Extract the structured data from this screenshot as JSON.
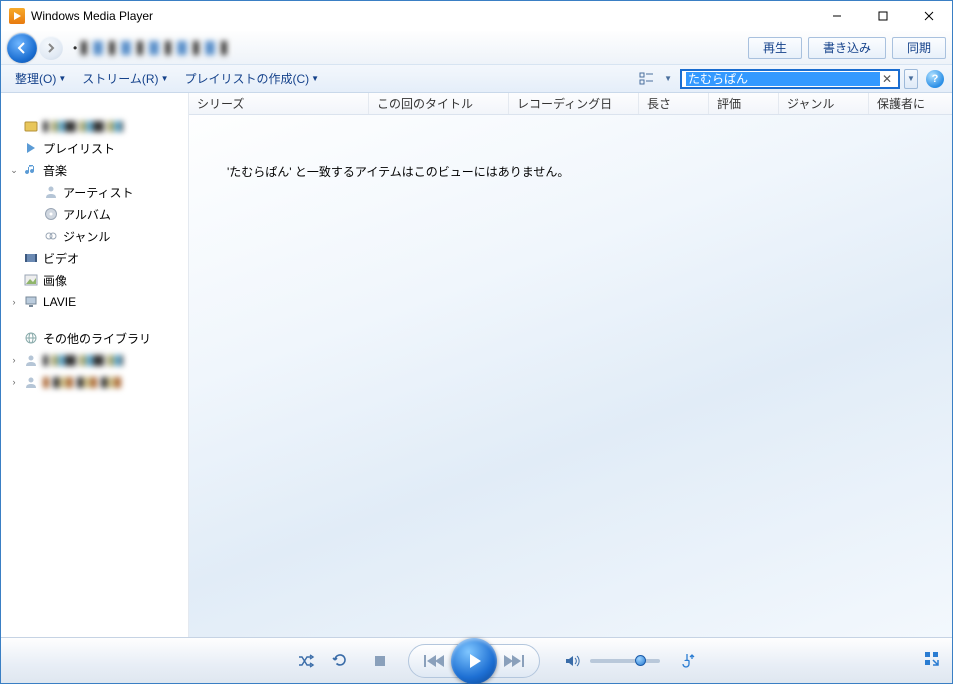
{
  "app": {
    "title": "Windows Media Player"
  },
  "tabs": {
    "play": "再生",
    "burn": "書き込み",
    "sync": "同期"
  },
  "toolbar": {
    "organize": "整理(O)",
    "stream": "ストリーム(R)",
    "create_playlist": "プレイリストの作成(C)"
  },
  "search": {
    "value": "たむらぱん"
  },
  "sidebar": {
    "playlist": "プレイリスト",
    "music": "音楽",
    "artist": "アーティスト",
    "album": "アルバム",
    "genre": "ジャンル",
    "video": "ビデオ",
    "image": "画像",
    "lavie": "LAVIE",
    "other_libs": "その他のライブラリ"
  },
  "columns": {
    "series": "シリーズ",
    "episode_title": "この回のタイトル",
    "recording_date": "レコーディング日",
    "length": "長さ",
    "rating": "評価",
    "genre": "ジャンル",
    "parental": "保護者に"
  },
  "main": {
    "no_results": "'たむらぱん' と一致するアイテムはこのビューにはありません。"
  },
  "player": {
    "volume_pct": 65
  }
}
